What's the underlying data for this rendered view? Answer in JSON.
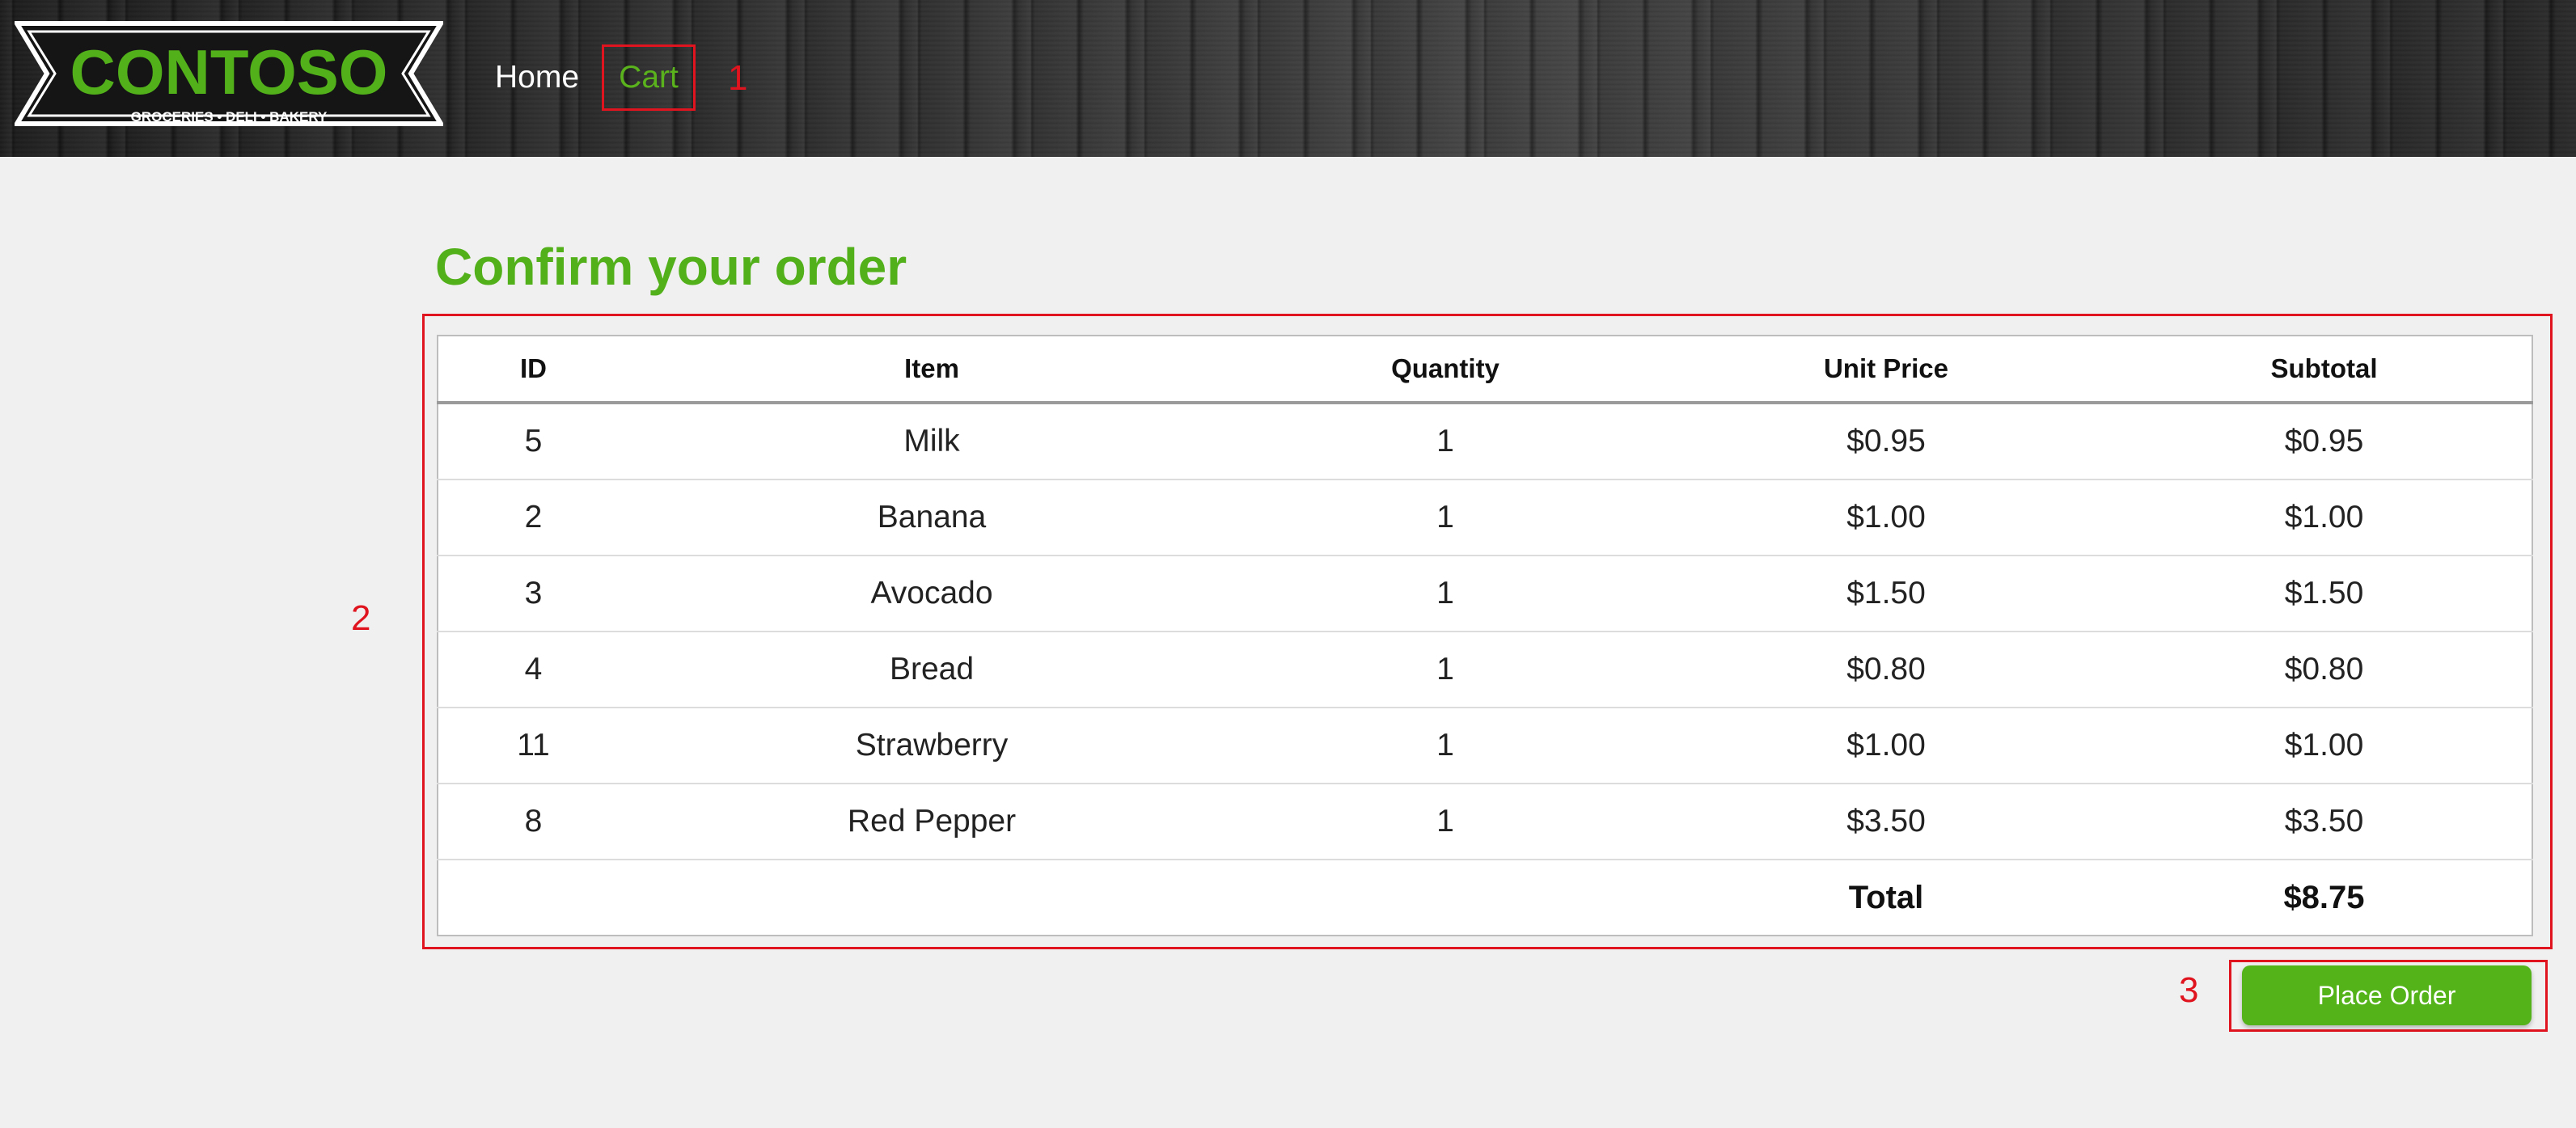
{
  "brand": {
    "name": "CONTOSO",
    "tagline": "GROCERIES • DELI • BAKERY",
    "primary_color": "#52b01a",
    "annotation_color": "#e0141e"
  },
  "nav": {
    "home_label": "Home",
    "cart_label": "Cart"
  },
  "annotations": [
    "1",
    "2",
    "3"
  ],
  "page": {
    "title": "Confirm your order"
  },
  "order_table": {
    "headers": [
      "ID",
      "Item",
      "Quantity",
      "Unit Price",
      "Subtotal"
    ],
    "rows": [
      {
        "id": "5",
        "item": "Milk",
        "quantity": "1",
        "unit_price": "$0.95",
        "subtotal": "$0.95"
      },
      {
        "id": "2",
        "item": "Banana",
        "quantity": "1",
        "unit_price": "$1.00",
        "subtotal": "$1.00"
      },
      {
        "id": "3",
        "item": "Avocado",
        "quantity": "1",
        "unit_price": "$1.50",
        "subtotal": "$1.50"
      },
      {
        "id": "4",
        "item": "Bread",
        "quantity": "1",
        "unit_price": "$0.80",
        "subtotal": "$0.80"
      },
      {
        "id": "11",
        "item": "Strawberry",
        "quantity": "1",
        "unit_price": "$1.00",
        "subtotal": "$1.00"
      },
      {
        "id": "8",
        "item": "Red Pepper",
        "quantity": "1",
        "unit_price": "$3.50",
        "subtotal": "$3.50"
      }
    ],
    "total_label": "Total",
    "total_value": "$8.75"
  },
  "actions": {
    "place_order_label": "Place Order"
  }
}
